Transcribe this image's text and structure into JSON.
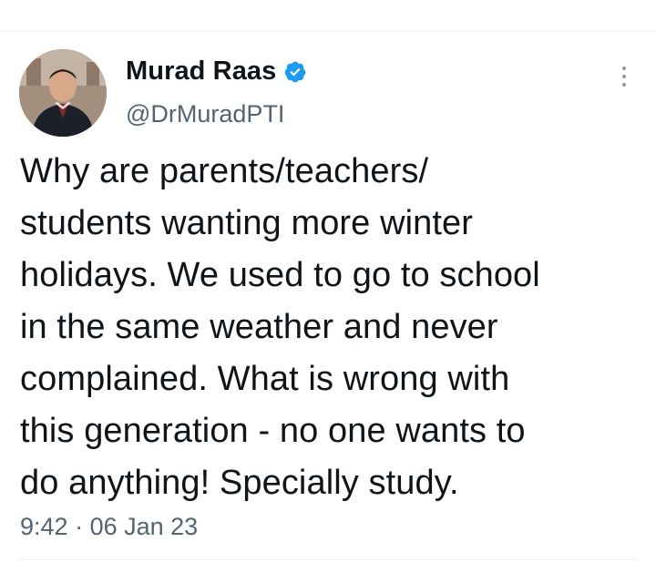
{
  "tweet": {
    "author": {
      "display_name": "Murad Raas",
      "handle": "@DrMuradPTI",
      "verified": true,
      "avatar_icon": "profile-photo",
      "verified_icon": "verified-badge-icon",
      "verified_color": "#1d9bf0"
    },
    "text": "Why are parents/teachers/\nstudents wanting more winter\nholidays. We used to go to school\nin the same weather and never\ncomplained. What is wrong with\nthis generation - no one wants to\ndo anything! Specially study.",
    "time": "9:42",
    "separator": "·",
    "date": "06 Jan 23",
    "more_icon": "more-options-icon"
  },
  "colors": {
    "text_primary": "#0f1419",
    "text_secondary": "#536471",
    "divider": "#eff3f4",
    "accent": "#1d9bf0"
  }
}
